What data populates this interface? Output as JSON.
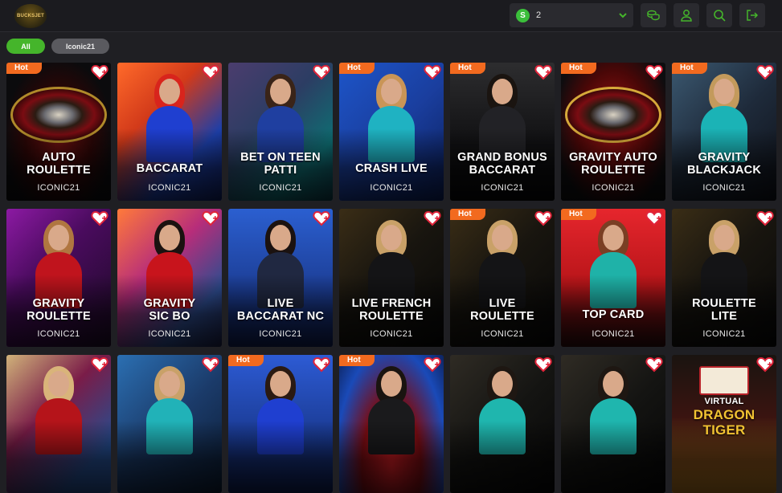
{
  "header": {
    "logo_text": "BUCKSJET",
    "balance": {
      "currency_symbol": "S",
      "value": "2"
    },
    "icons": [
      "coins-icon",
      "user-icon",
      "search-icon",
      "logout-icon"
    ]
  },
  "filters": [
    {
      "label": "All",
      "active": true
    },
    {
      "label": "Iconic21",
      "active": false
    }
  ],
  "hot_label": "Hot",
  "games": [
    {
      "title_lines": [
        "AUTO",
        "ROULETTE"
      ],
      "provider": "ICONIC21",
      "hot": true,
      "theme": "roulette"
    },
    {
      "title_lines": [
        "BACCARAT"
      ],
      "provider": "ICONIC21",
      "hot": false,
      "theme": "blue-red"
    },
    {
      "title_lines": [
        "BET ON TEEN",
        "PATTI"
      ],
      "provider": "ICONIC21",
      "hot": false,
      "theme": "teal"
    },
    {
      "title_lines": [
        "CRASH LIVE"
      ],
      "provider": "ICONIC21",
      "hot": true,
      "theme": "crash"
    },
    {
      "title_lines": [
        "GRAND BONUS",
        "BACCARAT"
      ],
      "provider": "ICONIC21",
      "hot": true,
      "theme": "dark"
    },
    {
      "title_lines": [
        "GRAVITY AUTO",
        "ROULETTE"
      ],
      "provider": "ICONIC21",
      "hot": true,
      "theme": "roulette-red"
    },
    {
      "title_lines": [
        "GRAVITY",
        "BLACKJACK"
      ],
      "provider": "ICONIC21",
      "hot": true,
      "theme": "blackjack"
    },
    {
      "title_lines": [
        "GRAVITY",
        "ROULETTE"
      ],
      "provider": "ICONIC21",
      "hot": false,
      "theme": "gravity"
    },
    {
      "title_lines": [
        "GRAVITY",
        "SIC BO"
      ],
      "provider": "ICONIC21",
      "hot": false,
      "theme": "sicbo"
    },
    {
      "title_lines": [
        "LIVE",
        "BACCARAT NC"
      ],
      "provider": "ICONIC21",
      "hot": false,
      "theme": "baccarat-blue"
    },
    {
      "title_lines": [
        "LIVE FRENCH",
        "ROULETTE"
      ],
      "provider": "ICONIC21",
      "hot": false,
      "theme": "dark-gold"
    },
    {
      "title_lines": [
        "LIVE",
        "ROULETTE"
      ],
      "provider": "ICONIC21",
      "hot": true,
      "theme": "dark-gold"
    },
    {
      "title_lines": [
        "TOP CARD"
      ],
      "provider": "ICONIC21",
      "hot": true,
      "theme": "topcard"
    },
    {
      "title_lines": [
        "ROULETTE",
        "LITE"
      ],
      "provider": "ICONIC21",
      "hot": false,
      "theme": "dark-gold"
    },
    {
      "title_lines": [],
      "provider": "",
      "hot": false,
      "theme": "red-dress"
    },
    {
      "title_lines": [],
      "provider": "",
      "hot": false,
      "theme": "speed"
    },
    {
      "title_lines": [],
      "provider": "",
      "hot": true,
      "theme": "takedeal"
    },
    {
      "title_lines": [],
      "provider": "",
      "hot": true,
      "theme": "red-blue"
    },
    {
      "title_lines": [],
      "provider": "",
      "hot": false,
      "theme": "vip-dark"
    },
    {
      "title_lines": [],
      "provider": "",
      "hot": false,
      "theme": "vip-dark"
    },
    {
      "title_lines": [
        "VIRTUAL",
        "DRAGON",
        "TIGER"
      ],
      "provider": "",
      "hot": false,
      "theme": "dragon"
    }
  ],
  "colors": {
    "accent_green": "#45b52b",
    "hot_orange": "#f26a1f",
    "topbar_bg": "#1b1b1f",
    "page_bg": "#1f1f23"
  }
}
